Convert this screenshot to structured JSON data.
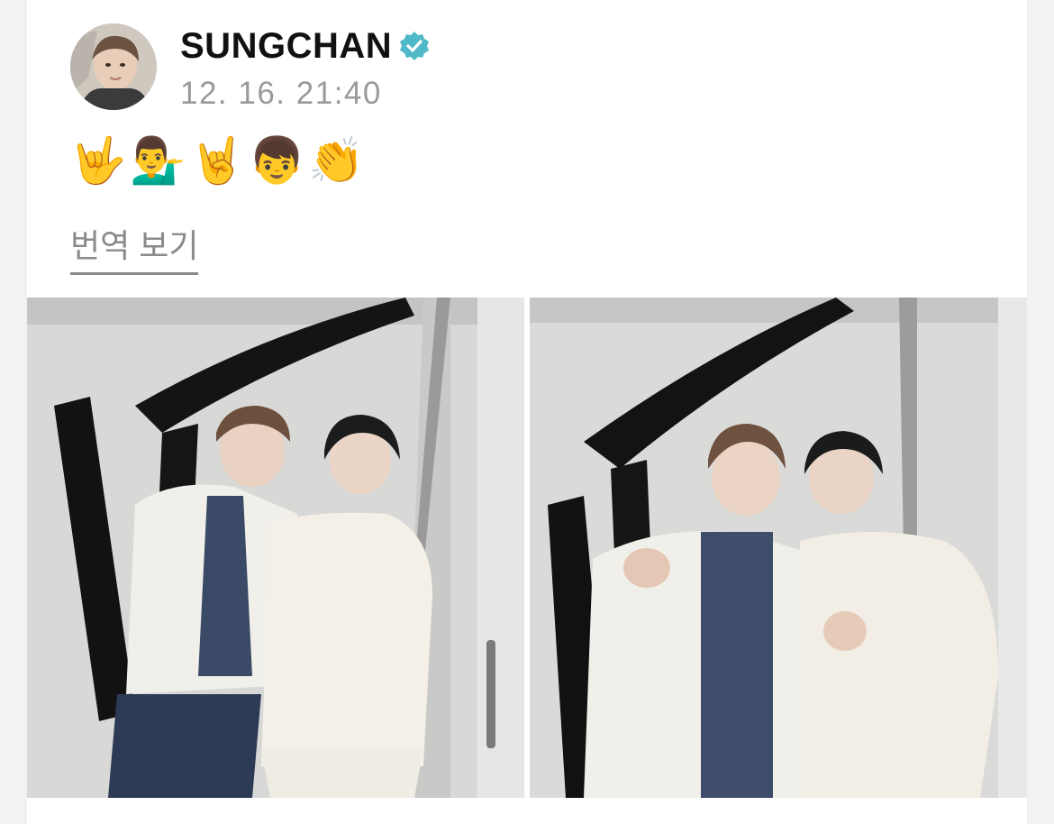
{
  "post": {
    "author": "SUNGCHAN",
    "timestamp": "12. 16. 21:40",
    "emojis": [
      "🤟",
      "💁‍♂️",
      "🤘",
      "👦",
      "👏"
    ],
    "translate_label": "번역 보기",
    "verified_color": "#4fb8c9"
  }
}
